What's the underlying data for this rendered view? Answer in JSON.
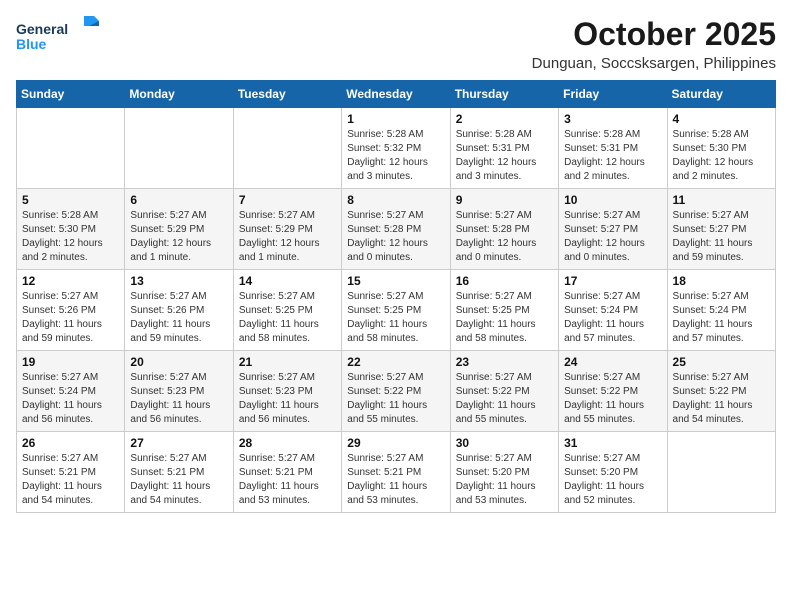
{
  "logo": {
    "line1": "General",
    "line2": "Blue"
  },
  "title": "October 2025",
  "subtitle": "Dunguan, Soccsksargen, Philippines",
  "weekdays": [
    "Sunday",
    "Monday",
    "Tuesday",
    "Wednesday",
    "Thursday",
    "Friday",
    "Saturday"
  ],
  "weeks": [
    [
      {
        "day": "",
        "sunrise": "",
        "sunset": "",
        "daylight": ""
      },
      {
        "day": "",
        "sunrise": "",
        "sunset": "",
        "daylight": ""
      },
      {
        "day": "",
        "sunrise": "",
        "sunset": "",
        "daylight": ""
      },
      {
        "day": "1",
        "sunrise": "Sunrise: 5:28 AM",
        "sunset": "Sunset: 5:32 PM",
        "daylight": "Daylight: 12 hours and 3 minutes."
      },
      {
        "day": "2",
        "sunrise": "Sunrise: 5:28 AM",
        "sunset": "Sunset: 5:31 PM",
        "daylight": "Daylight: 12 hours and 3 minutes."
      },
      {
        "day": "3",
        "sunrise": "Sunrise: 5:28 AM",
        "sunset": "Sunset: 5:31 PM",
        "daylight": "Daylight: 12 hours and 2 minutes."
      },
      {
        "day": "4",
        "sunrise": "Sunrise: 5:28 AM",
        "sunset": "Sunset: 5:30 PM",
        "daylight": "Daylight: 12 hours and 2 minutes."
      }
    ],
    [
      {
        "day": "5",
        "sunrise": "Sunrise: 5:28 AM",
        "sunset": "Sunset: 5:30 PM",
        "daylight": "Daylight: 12 hours and 2 minutes."
      },
      {
        "day": "6",
        "sunrise": "Sunrise: 5:27 AM",
        "sunset": "Sunset: 5:29 PM",
        "daylight": "Daylight: 12 hours and 1 minute."
      },
      {
        "day": "7",
        "sunrise": "Sunrise: 5:27 AM",
        "sunset": "Sunset: 5:29 PM",
        "daylight": "Daylight: 12 hours and 1 minute."
      },
      {
        "day": "8",
        "sunrise": "Sunrise: 5:27 AM",
        "sunset": "Sunset: 5:28 PM",
        "daylight": "Daylight: 12 hours and 0 minutes."
      },
      {
        "day": "9",
        "sunrise": "Sunrise: 5:27 AM",
        "sunset": "Sunset: 5:28 PM",
        "daylight": "Daylight: 12 hours and 0 minutes."
      },
      {
        "day": "10",
        "sunrise": "Sunrise: 5:27 AM",
        "sunset": "Sunset: 5:27 PM",
        "daylight": "Daylight: 12 hours and 0 minutes."
      },
      {
        "day": "11",
        "sunrise": "Sunrise: 5:27 AM",
        "sunset": "Sunset: 5:27 PM",
        "daylight": "Daylight: 11 hours and 59 minutes."
      }
    ],
    [
      {
        "day": "12",
        "sunrise": "Sunrise: 5:27 AM",
        "sunset": "Sunset: 5:26 PM",
        "daylight": "Daylight: 11 hours and 59 minutes."
      },
      {
        "day": "13",
        "sunrise": "Sunrise: 5:27 AM",
        "sunset": "Sunset: 5:26 PM",
        "daylight": "Daylight: 11 hours and 59 minutes."
      },
      {
        "day": "14",
        "sunrise": "Sunrise: 5:27 AM",
        "sunset": "Sunset: 5:25 PM",
        "daylight": "Daylight: 11 hours and 58 minutes."
      },
      {
        "day": "15",
        "sunrise": "Sunrise: 5:27 AM",
        "sunset": "Sunset: 5:25 PM",
        "daylight": "Daylight: 11 hours and 58 minutes."
      },
      {
        "day": "16",
        "sunrise": "Sunrise: 5:27 AM",
        "sunset": "Sunset: 5:25 PM",
        "daylight": "Daylight: 11 hours and 58 minutes."
      },
      {
        "day": "17",
        "sunrise": "Sunrise: 5:27 AM",
        "sunset": "Sunset: 5:24 PM",
        "daylight": "Daylight: 11 hours and 57 minutes."
      },
      {
        "day": "18",
        "sunrise": "Sunrise: 5:27 AM",
        "sunset": "Sunset: 5:24 PM",
        "daylight": "Daylight: 11 hours and 57 minutes."
      }
    ],
    [
      {
        "day": "19",
        "sunrise": "Sunrise: 5:27 AM",
        "sunset": "Sunset: 5:24 PM",
        "daylight": "Daylight: 11 hours and 56 minutes."
      },
      {
        "day": "20",
        "sunrise": "Sunrise: 5:27 AM",
        "sunset": "Sunset: 5:23 PM",
        "daylight": "Daylight: 11 hours and 56 minutes."
      },
      {
        "day": "21",
        "sunrise": "Sunrise: 5:27 AM",
        "sunset": "Sunset: 5:23 PM",
        "daylight": "Daylight: 11 hours and 56 minutes."
      },
      {
        "day": "22",
        "sunrise": "Sunrise: 5:27 AM",
        "sunset": "Sunset: 5:22 PM",
        "daylight": "Daylight: 11 hours and 55 minutes."
      },
      {
        "day": "23",
        "sunrise": "Sunrise: 5:27 AM",
        "sunset": "Sunset: 5:22 PM",
        "daylight": "Daylight: 11 hours and 55 minutes."
      },
      {
        "day": "24",
        "sunrise": "Sunrise: 5:27 AM",
        "sunset": "Sunset: 5:22 PM",
        "daylight": "Daylight: 11 hours and 55 minutes."
      },
      {
        "day": "25",
        "sunrise": "Sunrise: 5:27 AM",
        "sunset": "Sunset: 5:22 PM",
        "daylight": "Daylight: 11 hours and 54 minutes."
      }
    ],
    [
      {
        "day": "26",
        "sunrise": "Sunrise: 5:27 AM",
        "sunset": "Sunset: 5:21 PM",
        "daylight": "Daylight: 11 hours and 54 minutes."
      },
      {
        "day": "27",
        "sunrise": "Sunrise: 5:27 AM",
        "sunset": "Sunset: 5:21 PM",
        "daylight": "Daylight: 11 hours and 54 minutes."
      },
      {
        "day": "28",
        "sunrise": "Sunrise: 5:27 AM",
        "sunset": "Sunset: 5:21 PM",
        "daylight": "Daylight: 11 hours and 53 minutes."
      },
      {
        "day": "29",
        "sunrise": "Sunrise: 5:27 AM",
        "sunset": "Sunset: 5:21 PM",
        "daylight": "Daylight: 11 hours and 53 minutes."
      },
      {
        "day": "30",
        "sunrise": "Sunrise: 5:27 AM",
        "sunset": "Sunset: 5:20 PM",
        "daylight": "Daylight: 11 hours and 53 minutes."
      },
      {
        "day": "31",
        "sunrise": "Sunrise: 5:27 AM",
        "sunset": "Sunset: 5:20 PM",
        "daylight": "Daylight: 11 hours and 52 minutes."
      },
      {
        "day": "",
        "sunrise": "",
        "sunset": "",
        "daylight": ""
      }
    ]
  ]
}
